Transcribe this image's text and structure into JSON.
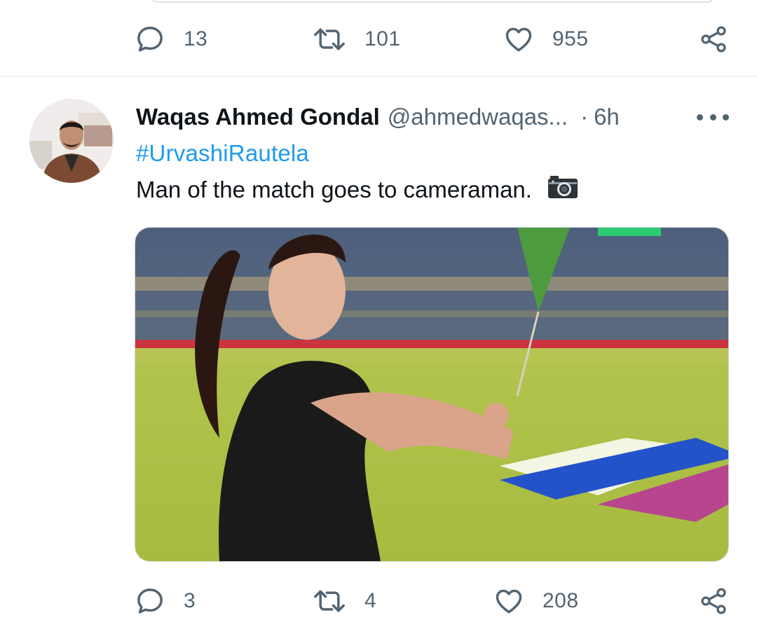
{
  "previous_tweet": {
    "actions": {
      "replies": "13",
      "retweets": "101",
      "likes": "955"
    }
  },
  "tweet": {
    "author_name": "Waqas Ahmed Gondal",
    "author_handle": "@ahmedwaqas...",
    "separator": "·",
    "time": "6h",
    "hashtag": "#UrvashiRautela",
    "text": "Man of the match goes to cameraman.",
    "text_emoji_icon": "camera-emoji-icon",
    "actions": {
      "replies": "3",
      "retweets": "4",
      "likes": "208"
    }
  },
  "icons": {
    "reply": "reply-icon",
    "retweet": "retweet-icon",
    "like": "heart-icon",
    "share": "share-icon",
    "more": "more-options-icon"
  },
  "colors": {
    "link": "#1d9bf0",
    "secondary_text": "#536471",
    "primary_text": "#0f1419",
    "divider": "#eff3f4"
  }
}
